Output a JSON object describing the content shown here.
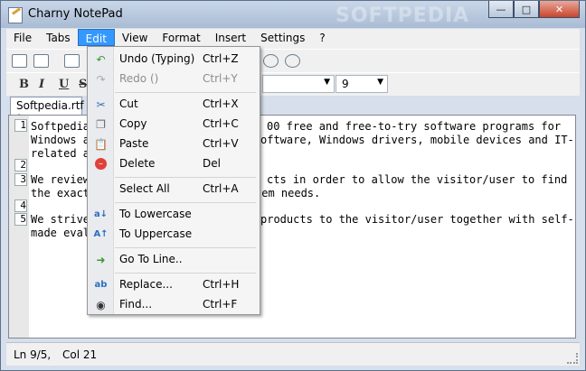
{
  "window": {
    "title": "Charny NotePad",
    "watermark": "SOFTPEDIA"
  },
  "menubar": [
    "File",
    "Tabs",
    "Edit",
    "View",
    "Format",
    "Insert",
    "Settings",
    "?"
  ],
  "format_toolbar": {
    "bold": "B",
    "italic": "I",
    "underline": "U",
    "strike": "S",
    "font_size": "9"
  },
  "tab": {
    "label": "Softpedia.rtf *"
  },
  "editor": {
    "line_numbers": [
      "1",
      "2",
      "3",
      "4",
      "5"
    ],
    "lines": [
      "Softpedia",
      "00 free and free-to-try software programs for",
      "Windows a",
      "oftware, Windows drivers, mobile devices and IT-",
      "related a",
      "We review",
      "cts in order to allow the visitor/user to find",
      "the exact",
      "tem needs.",
      "We strive",
      "products to the visitor/user together with self-",
      "made eval"
    ]
  },
  "status": {
    "line": "Ln 9/5,",
    "col": "Col 21"
  },
  "edit_menu": [
    {
      "label": "Undo (Typing)",
      "shortcut": "Ctrl+Z",
      "icon": "undo-icon",
      "disabled": false
    },
    {
      "label": "Redo ()",
      "shortcut": "Ctrl+Y",
      "icon": "redo-icon",
      "disabled": true
    },
    {
      "label": "Cut",
      "shortcut": "Ctrl+X",
      "icon": "scissors-icon",
      "disabled": false
    },
    {
      "label": "Copy",
      "shortcut": "Ctrl+C",
      "icon": "copy-icon",
      "disabled": false
    },
    {
      "label": "Paste",
      "shortcut": "Ctrl+V",
      "icon": "paste-icon",
      "disabled": false
    },
    {
      "label": "Delete",
      "shortcut": "Del",
      "icon": "delete-icon",
      "disabled": false
    },
    {
      "label": "Select All",
      "shortcut": "Ctrl+A",
      "icon": "",
      "disabled": false
    },
    {
      "label": "To Lowercase",
      "shortcut": "",
      "icon": "lowercase-icon",
      "disabled": false
    },
    {
      "label": "To Uppercase",
      "shortcut": "",
      "icon": "uppercase-icon",
      "disabled": false
    },
    {
      "label": "Go To Line..",
      "shortcut": "",
      "icon": "arrow-right-icon",
      "disabled": false
    },
    {
      "label": "Replace...",
      "shortcut": "Ctrl+H",
      "icon": "replace-icon",
      "disabled": false
    },
    {
      "label": "Find...",
      "shortcut": "Ctrl+F",
      "icon": "binoculars-icon",
      "disabled": false
    }
  ],
  "colors": {
    "menu_highlight": "#3399ff",
    "delete_icon": "#e0403a",
    "go_to_arrow": "#3a9a2a"
  }
}
